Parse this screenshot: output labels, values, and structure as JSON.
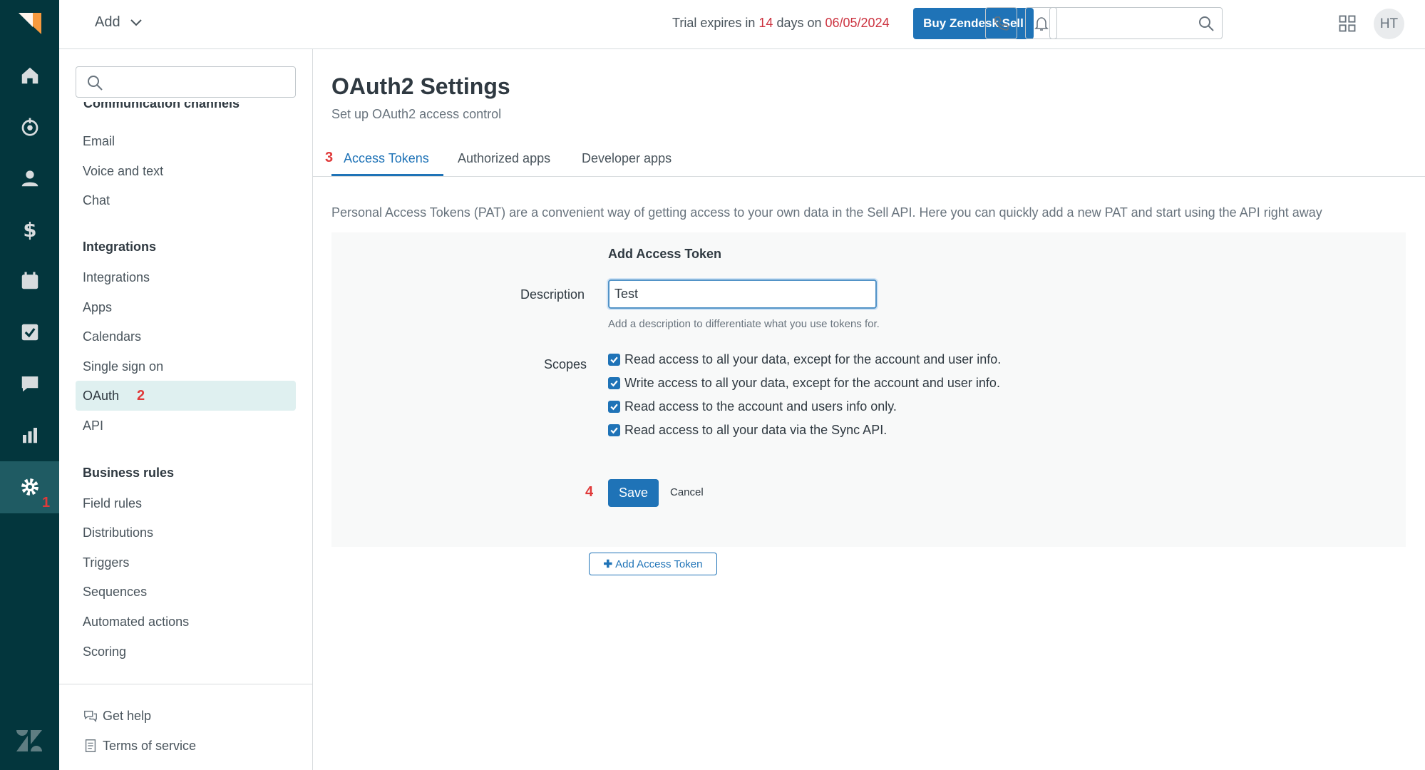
{
  "colors": {
    "rail": "#03363d",
    "accent": "#1f73b7",
    "red": "#cc3340",
    "active_bg": "#dff0f0"
  },
  "topbar": {
    "add_label": "Add",
    "trial_prefix": "Trial expires in",
    "trial_days": "14",
    "trial_mid": "days on",
    "trial_date": "06/05/2024",
    "buy_label": "Buy Zendesk Sell",
    "avatar_initials": "HT",
    "icons": [
      "search-icon",
      "phone-icon",
      "bell-icon",
      "apps-grid-icon"
    ]
  },
  "rail": {
    "items": [
      "home-icon",
      "leads-icon",
      "contacts-icon",
      "deals-icon",
      "calendar-icon",
      "tasks-icon",
      "messages-icon",
      "reports-icon",
      "settings-icon"
    ],
    "settings_badge": "1"
  },
  "sidebar": {
    "cut_heading": "Communication channels",
    "comm_items": [
      "Email",
      "Voice and text",
      "Chat"
    ],
    "integrations_heading": "Integrations",
    "integrations_items": [
      "Integrations",
      "Apps",
      "Calendars",
      "Single sign on",
      "OAuth",
      "API"
    ],
    "oauth_badge": "2",
    "business_heading": "Business rules",
    "business_items": [
      "Field rules",
      "Distributions",
      "Triggers",
      "Sequences",
      "Automated actions",
      "Scoring"
    ],
    "footer": {
      "help": "Get help",
      "terms": "Terms of service"
    }
  },
  "main": {
    "title": "OAuth2 Settings",
    "subtitle": "Set up OAuth2 access control",
    "tab_badge": "3",
    "tabs": [
      "Access Tokens",
      "Authorized apps",
      "Developer apps"
    ],
    "description": "Personal Access Tokens (PAT) are a convenient way of getting access to your own data in the Sell API. Here you can quickly add a new PAT and start using the API right away",
    "form": {
      "title": "Add Access Token",
      "description_label": "Description",
      "description_value": "Test",
      "hint": "Add a description to differentiate what you use tokens for.",
      "scopes_label": "Scopes",
      "scopes": [
        "Read access to all your data, except for the account and user info.",
        "Write access to all your data, except for the account and user info.",
        "Read access to the account and users info only.",
        "Read access to all your data via the Sync API."
      ],
      "save_badge": "4",
      "save_label": "Save",
      "cancel_label": "Cancel"
    },
    "add_token_label": "Add Access Token"
  }
}
